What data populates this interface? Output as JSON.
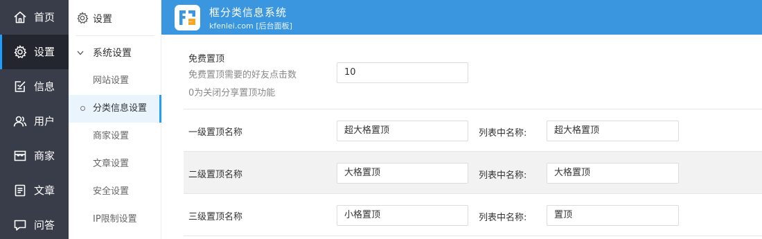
{
  "nav": {
    "items": [
      {
        "label": "首页",
        "icon": "home-icon"
      },
      {
        "label": "设置",
        "icon": "gear-icon"
      },
      {
        "label": "信息",
        "icon": "edit-icon"
      },
      {
        "label": "用户",
        "icon": "users-icon"
      },
      {
        "label": "商家",
        "icon": "store-icon"
      },
      {
        "label": "文章",
        "icon": "article-icon"
      },
      {
        "label": "问答",
        "icon": "chat-icon"
      }
    ],
    "active_index": 1
  },
  "submenu": {
    "title": "设置",
    "group": "系统设置",
    "items": [
      "网站设置",
      "分类信息设置",
      "商家设置",
      "文章设置",
      "安全设置",
      "IP限制设置"
    ],
    "active_index": 1
  },
  "header": {
    "title": "框分类信息系统",
    "subtitle": "kfenlei.com [后台面板]"
  },
  "form": {
    "free_top": {
      "label": "免费置顶",
      "desc1": "免费置顶需要的好友点击数",
      "desc2": "0为关闭分享置顶功能",
      "value": "10"
    },
    "levels": [
      {
        "label": "一级置顶名称",
        "value": "超大格置顶",
        "list_label": "列表中名称:",
        "list_value": "超大格置顶"
      },
      {
        "label": "二级置顶名称",
        "value": "大格置顶",
        "list_label": "列表中名称:",
        "list_value": "大格置顶"
      },
      {
        "label": "三级置顶名称",
        "value": "小格置顶",
        "list_label": "列表中名称:",
        "list_value": "置顶"
      }
    ]
  },
  "colors": {
    "nav_bg": "#393d49",
    "header_bg": "#3a96de",
    "accent": "#1e9fff",
    "logo_orange": "#f5a623"
  }
}
